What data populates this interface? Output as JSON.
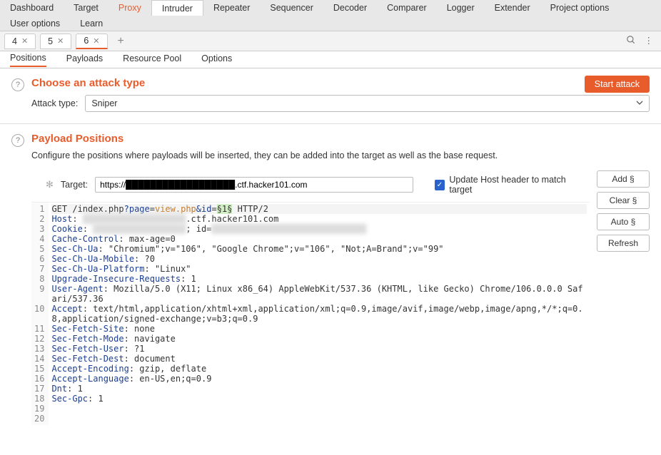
{
  "topTabs": {
    "dashboard": "Dashboard",
    "target": "Target",
    "proxy": "Proxy",
    "intruder": "Intruder",
    "repeater": "Repeater",
    "sequencer": "Sequencer",
    "decoder": "Decoder",
    "comparer": "Comparer",
    "logger": "Logger",
    "extender": "Extender",
    "projectOptions": "Project options",
    "userOptions": "User options",
    "learn": "Learn"
  },
  "numTabs": {
    "t4": "4",
    "t5": "5",
    "t6": "6",
    "close": "✕",
    "add": "+"
  },
  "subTabs": {
    "positions": "Positions",
    "payloads": "Payloads",
    "resourcePool": "Resource Pool",
    "options": "Options"
  },
  "attack": {
    "title": "Choose an attack type",
    "startBtn": "Start attack",
    "label": "Attack type:",
    "selected": "Sniper"
  },
  "positions": {
    "title": "Payload Positions",
    "desc": "Configure the positions where payloads will be inserted, they can be added into the target as well as the base request.",
    "targetLabel": "Target:",
    "targetValue": "https://██████████████████.ctf.hacker101.com",
    "updateHost": "Update Host header to match target"
  },
  "buttons": {
    "add": "Add §",
    "clear": "Clear §",
    "auto": "Auto §",
    "refresh": "Refresh"
  },
  "request": {
    "method": "GET",
    "path": "/index.php",
    "query_prefix": "?",
    "param1_key": "page",
    "param1_val": "view.php",
    "amp": "&",
    "param2_key": "id",
    "marker_open": "§",
    "param2_val": "1",
    "marker_close": "§",
    "proto": " HTTP/2",
    "lines": [
      {
        "n": 2,
        "h": "Host",
        "v": ": ████████████████████.ctf.hacker101.com"
      },
      {
        "n": 3,
        "h": "Cookie",
        "v": ": ██████████████████; id=██████████████████████████████"
      },
      {
        "n": 4,
        "h": "Cache-Control",
        "v": ": max-age=0"
      },
      {
        "n": 5,
        "h": "Sec-Ch-Ua",
        "v": ": \"Chromium\";v=\"106\", \"Google Chrome\";v=\"106\", \"Not;A=Brand\";v=\"99\""
      },
      {
        "n": 6,
        "h": "Sec-Ch-Ua-Mobile",
        "v": ": ?0"
      },
      {
        "n": 7,
        "h": "Sec-Ch-Ua-Platform",
        "v": ": \"Linux\""
      },
      {
        "n": 8,
        "h": "Upgrade-Insecure-Requests",
        "v": ": 1"
      },
      {
        "n": 9,
        "h": "User-Agent",
        "v": ": Mozilla/5.0 (X11; Linux x86_64) AppleWebKit/537.36 (KHTML, like Gecko) Chrome/106.0.0.0 Safari/537.36"
      },
      {
        "n": 10,
        "h": "Accept",
        "v": ": text/html,application/xhtml+xml,application/xml;q=0.9,image/avif,image/webp,image/apng,*/*;q=0.8,application/signed-exchange;v=b3;q=0.9"
      },
      {
        "n": 11,
        "h": "Sec-Fetch-Site",
        "v": ": none"
      },
      {
        "n": 12,
        "h": "Sec-Fetch-Mode",
        "v": ": navigate"
      },
      {
        "n": 13,
        "h": "Sec-Fetch-User",
        "v": ": ?1"
      },
      {
        "n": 14,
        "h": "Sec-Fetch-Dest",
        "v": ": document"
      },
      {
        "n": 15,
        "h": "Accept-Encoding",
        "v": ": gzip, deflate"
      },
      {
        "n": 16,
        "h": "Accept-Language",
        "v": ": en-US,en;q=0.9"
      },
      {
        "n": 17,
        "h": "Dnt",
        "v": ": 1"
      },
      {
        "n": 18,
        "h": "Sec-Gpc",
        "v": ": 1"
      }
    ],
    "blank": [
      19,
      20
    ]
  }
}
